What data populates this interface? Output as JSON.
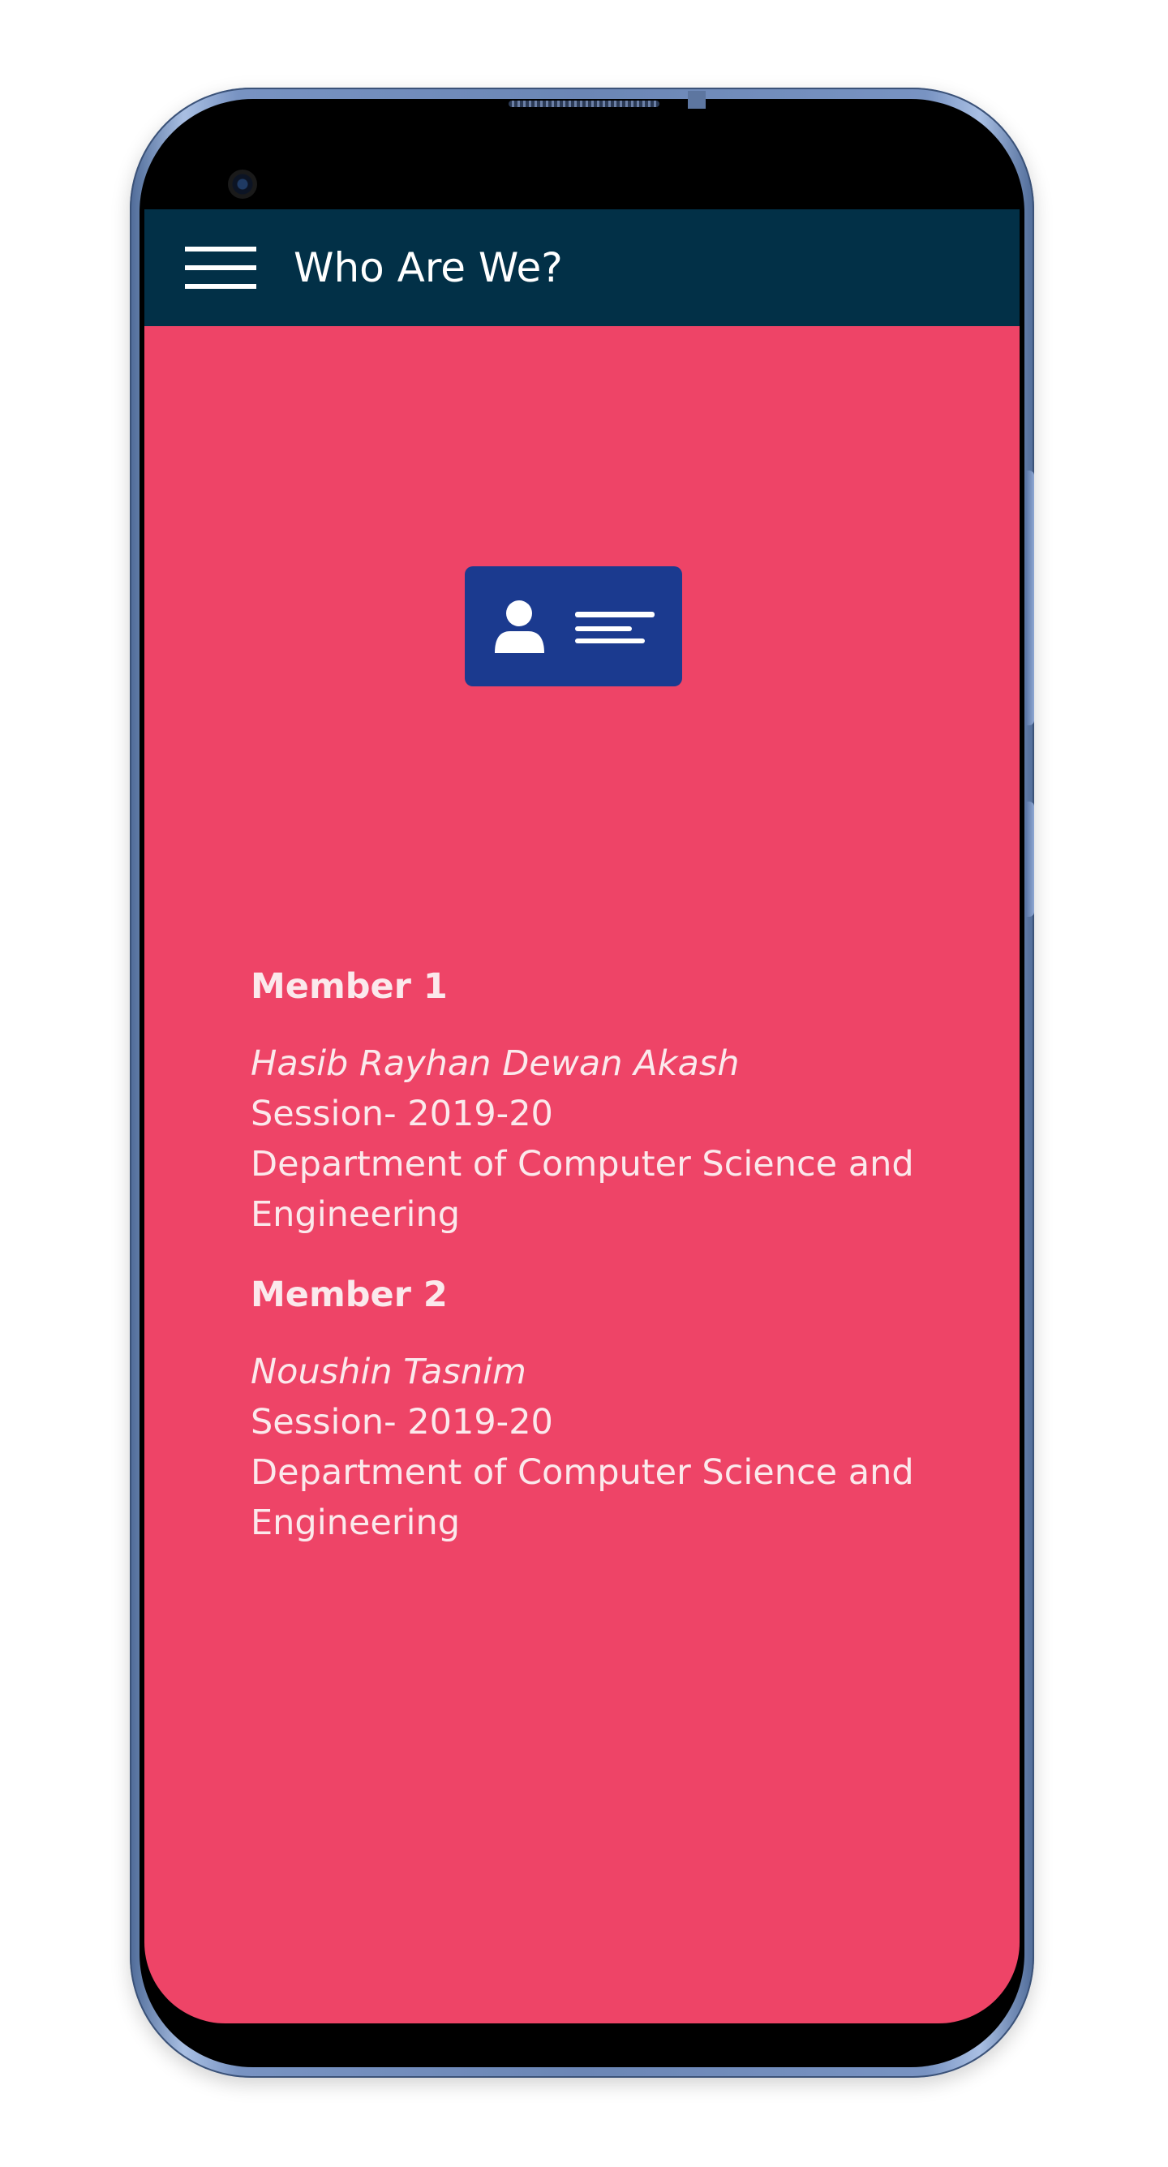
{
  "app_bar": {
    "title": "Who Are We?",
    "menu_icon": "hamburger-menu-icon",
    "background": "#023047"
  },
  "screen": {
    "background": "#ee4467",
    "hero_icon": "id-card-icon",
    "hero_icon_color": "#1b3a8f"
  },
  "members": [
    {
      "heading": "Member 1",
      "name": "Hasib Rayhan Dewan Akash",
      "session": "Session- 2019-20",
      "department": "Department of Computer Science and Engineering"
    },
    {
      "heading": "Member 2",
      "name": "Noushin Tasnim",
      "session": "Session- 2019-20",
      "department": "Department of Computer Science and Engineering"
    }
  ]
}
